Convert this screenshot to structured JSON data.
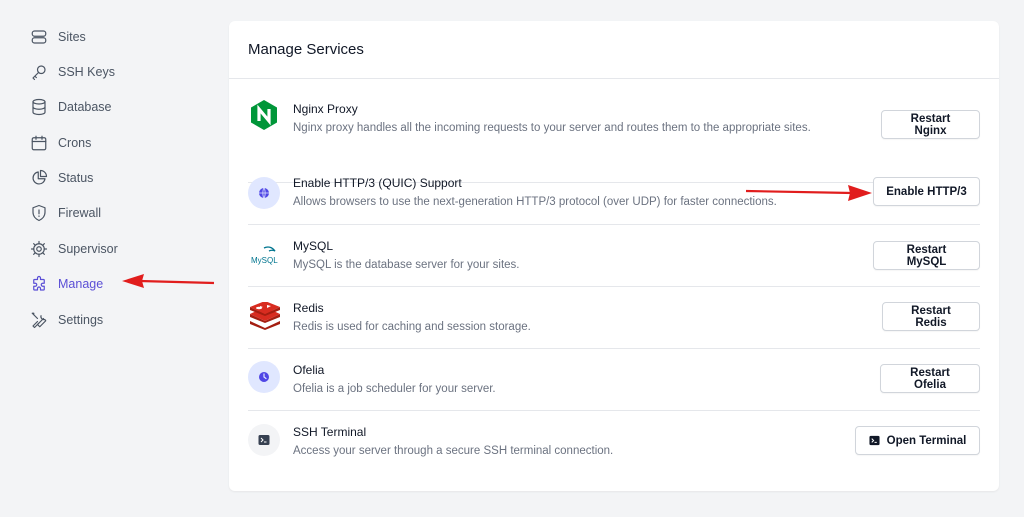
{
  "sidebar": {
    "items": [
      {
        "label": "Sites",
        "icon": "server-icon"
      },
      {
        "label": "SSH Keys",
        "icon": "key-icon"
      },
      {
        "label": "Database",
        "icon": "database-icon"
      },
      {
        "label": "Crons",
        "icon": "calendar-icon"
      },
      {
        "label": "Status",
        "icon": "pie-chart-icon"
      },
      {
        "label": "Firewall",
        "icon": "shield-icon"
      },
      {
        "label": "Supervisor",
        "icon": "gear-icon"
      },
      {
        "label": "Manage",
        "icon": "puzzle-icon",
        "active": true
      },
      {
        "label": "Settings",
        "icon": "tools-icon"
      }
    ],
    "active_color": "#5b4fd6"
  },
  "main": {
    "title": "Manage Services",
    "services": [
      {
        "name": "Nginx Proxy",
        "description": "Nginx proxy handles all the incoming requests to your server and routes them to the appropriate sites.",
        "button": "Restart Nginx",
        "icon": "nginx-logo-icon"
      },
      {
        "name": "Enable HTTP/3 (QUIC) Support",
        "description": "Allows browsers to use the next-generation HTTP/3 protocol (over UDP) for faster connections.",
        "button": "Enable HTTP/3",
        "icon": "globe-icon"
      },
      {
        "name": "MySQL",
        "description": "MySQL is the database server for your sites.",
        "button": "Restart MySQL",
        "icon": "mysql-logo-icon",
        "logo_text": "MySQL"
      },
      {
        "name": "Redis",
        "description": "Redis is used for caching and session storage.",
        "button": "Restart Redis",
        "icon": "redis-logo-icon"
      },
      {
        "name": "Ofelia",
        "description": "Ofelia is a job scheduler for your server.",
        "button": "Restart Ofelia",
        "icon": "clock-icon"
      },
      {
        "name": "SSH Terminal",
        "description": "Access your server through a secure SSH terminal connection.",
        "button": "Open Terminal",
        "icon": "terminal-icon"
      }
    ]
  },
  "annotations": {
    "arrow_color": "#e11d1d"
  }
}
